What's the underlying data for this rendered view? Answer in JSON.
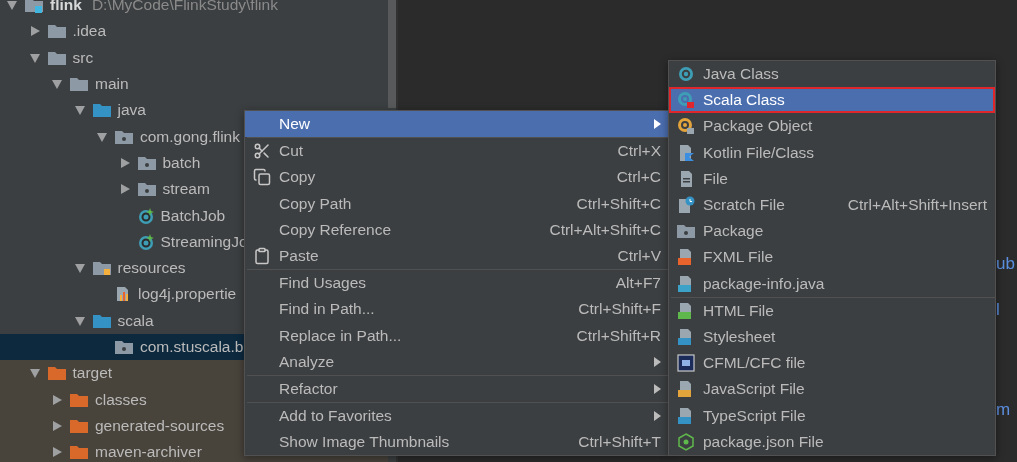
{
  "project_tree": {
    "items": [
      {
        "label": "flink",
        "path": "D:\\MyCode\\FlinkStudy\\flink",
        "kind": "module",
        "expanded": true,
        "selected": false,
        "excluded": false,
        "children": [
          {
            "label": ".idea",
            "kind": "folder",
            "expanded": false,
            "selected": false,
            "excluded": false
          },
          {
            "label": "src",
            "kind": "folder",
            "expanded": true,
            "selected": false,
            "excluded": false,
            "children": [
              {
                "label": "main",
                "kind": "folder",
                "expanded": true,
                "selected": false,
                "excluded": false,
                "children": [
                  {
                    "label": "java",
                    "kind": "source-folder",
                    "expanded": true,
                    "selected": false,
                    "excluded": false,
                    "children": [
                      {
                        "label": "com.gong.flink",
                        "kind": "package",
                        "expanded": true,
                        "selected": false,
                        "excluded": false,
                        "children": [
                          {
                            "label": "batch",
                            "kind": "package",
                            "expanded": false,
                            "selected": false,
                            "excluded": false
                          },
                          {
                            "label": "stream",
                            "kind": "package",
                            "expanded": false,
                            "selected": false,
                            "excluded": false
                          },
                          {
                            "label": "BatchJob",
                            "kind": "class",
                            "selected": false,
                            "excluded": false
                          },
                          {
                            "label": "StreamingJo",
                            "kind": "class",
                            "selected": false,
                            "excluded": false
                          }
                        ]
                      }
                    ]
                  },
                  {
                    "label": "resources",
                    "kind": "resources",
                    "expanded": true,
                    "selected": false,
                    "excluded": false,
                    "children": [
                      {
                        "label": "log4j.propertie",
                        "kind": "properties",
                        "selected": false,
                        "excluded": false
                      }
                    ]
                  },
                  {
                    "label": "scala",
                    "kind": "source-folder",
                    "expanded": true,
                    "selected": false,
                    "excluded": false,
                    "children": [
                      {
                        "label": "com.stuscala.b",
                        "kind": "package",
                        "selected": true,
                        "excluded": false
                      }
                    ]
                  }
                ]
              }
            ]
          },
          {
            "label": "target",
            "kind": "excluded-folder",
            "expanded": true,
            "selected": false,
            "excluded": true,
            "children": [
              {
                "label": "classes",
                "kind": "excluded-folder",
                "expanded": false,
                "selected": false,
                "excluded": true
              },
              {
                "label": "generated-sources",
                "kind": "excluded-folder",
                "expanded": false,
                "selected": false,
                "excluded": true
              },
              {
                "label": "maven-archiver",
                "kind": "excluded-folder",
                "expanded": false,
                "selected": false,
                "excluded": true
              }
            ]
          }
        ]
      }
    ]
  },
  "editor": {
    "fragments": [
      "ub",
      "l",
      "m"
    ]
  },
  "context_menu": {
    "items": [
      {
        "kind": "plain",
        "label": "New",
        "submenu": true,
        "selected": true
      },
      {
        "kind": "separator"
      },
      {
        "kind": "scissors",
        "label": "Cut",
        "shortcut": "Ctrl+X",
        "selected": false
      },
      {
        "kind": "copy",
        "label": "Copy",
        "shortcut": "Ctrl+C",
        "selected": false
      },
      {
        "kind": "plain",
        "label": "Copy Path",
        "shortcut": "Ctrl+Shift+C",
        "selected": false
      },
      {
        "kind": "plain",
        "label": "Copy Reference",
        "shortcut": "Ctrl+Alt+Shift+C",
        "selected": false
      },
      {
        "kind": "clipboard",
        "label": "Paste",
        "shortcut": "Ctrl+V",
        "selected": false
      },
      {
        "kind": "separator"
      },
      {
        "kind": "plain",
        "label": "Find Usages",
        "shortcut": "Alt+F7",
        "selected": false
      },
      {
        "kind": "plain",
        "label": "Find in Path...",
        "shortcut": "Ctrl+Shift+F",
        "selected": false
      },
      {
        "kind": "plain",
        "label": "Replace in Path...",
        "shortcut": "Ctrl+Shift+R",
        "selected": false
      },
      {
        "kind": "plain",
        "label": "Analyze",
        "submenu": true,
        "selected": false
      },
      {
        "kind": "separator"
      },
      {
        "kind": "plain",
        "label": "Refactor",
        "submenu": true,
        "selected": false
      },
      {
        "kind": "separator"
      },
      {
        "kind": "plain",
        "label": "Add to Favorites",
        "submenu": true,
        "selected": false
      },
      {
        "kind": "plain",
        "label": "Show Image Thumbnails",
        "shortcut": "Ctrl+Shift+T",
        "selected": false
      }
    ]
  },
  "new_submenu": {
    "items": [
      {
        "kind": "java-class",
        "label": "Java Class",
        "selected": false,
        "outlined": false
      },
      {
        "kind": "scala-class",
        "label": "Scala Class",
        "selected": true,
        "outlined": true
      },
      {
        "kind": "package-object",
        "label": "Package Object",
        "selected": false,
        "outlined": false
      },
      {
        "kind": "kotlin",
        "label": "Kotlin File/Class",
        "selected": false,
        "outlined": false
      },
      {
        "kind": "file",
        "label": "File",
        "selected": false,
        "outlined": false
      },
      {
        "kind": "scratch",
        "label": "Scratch File",
        "shortcut": "Ctrl+Alt+Shift+Insert",
        "selected": false,
        "outlined": false
      },
      {
        "kind": "package",
        "label": "Package",
        "selected": false,
        "outlined": false
      },
      {
        "kind": "fxml",
        "label": "FXML File",
        "selected": false,
        "outlined": false
      },
      {
        "kind": "java-file",
        "label": "package-info.java",
        "selected": false,
        "outlined": false
      },
      {
        "kind": "separator"
      },
      {
        "kind": "html",
        "label": "HTML File",
        "selected": false,
        "outlined": false
      },
      {
        "kind": "css",
        "label": "Stylesheet",
        "selected": false,
        "outlined": false
      },
      {
        "kind": "cfml",
        "label": "CFML/CFC file",
        "selected": false,
        "outlined": false
      },
      {
        "kind": "js",
        "label": "JavaScript File",
        "selected": false,
        "outlined": false
      },
      {
        "kind": "ts",
        "label": "TypeScript File",
        "selected": false,
        "outlined": false
      },
      {
        "kind": "node",
        "label": "package.json File",
        "selected": false,
        "outlined": false
      }
    ]
  }
}
